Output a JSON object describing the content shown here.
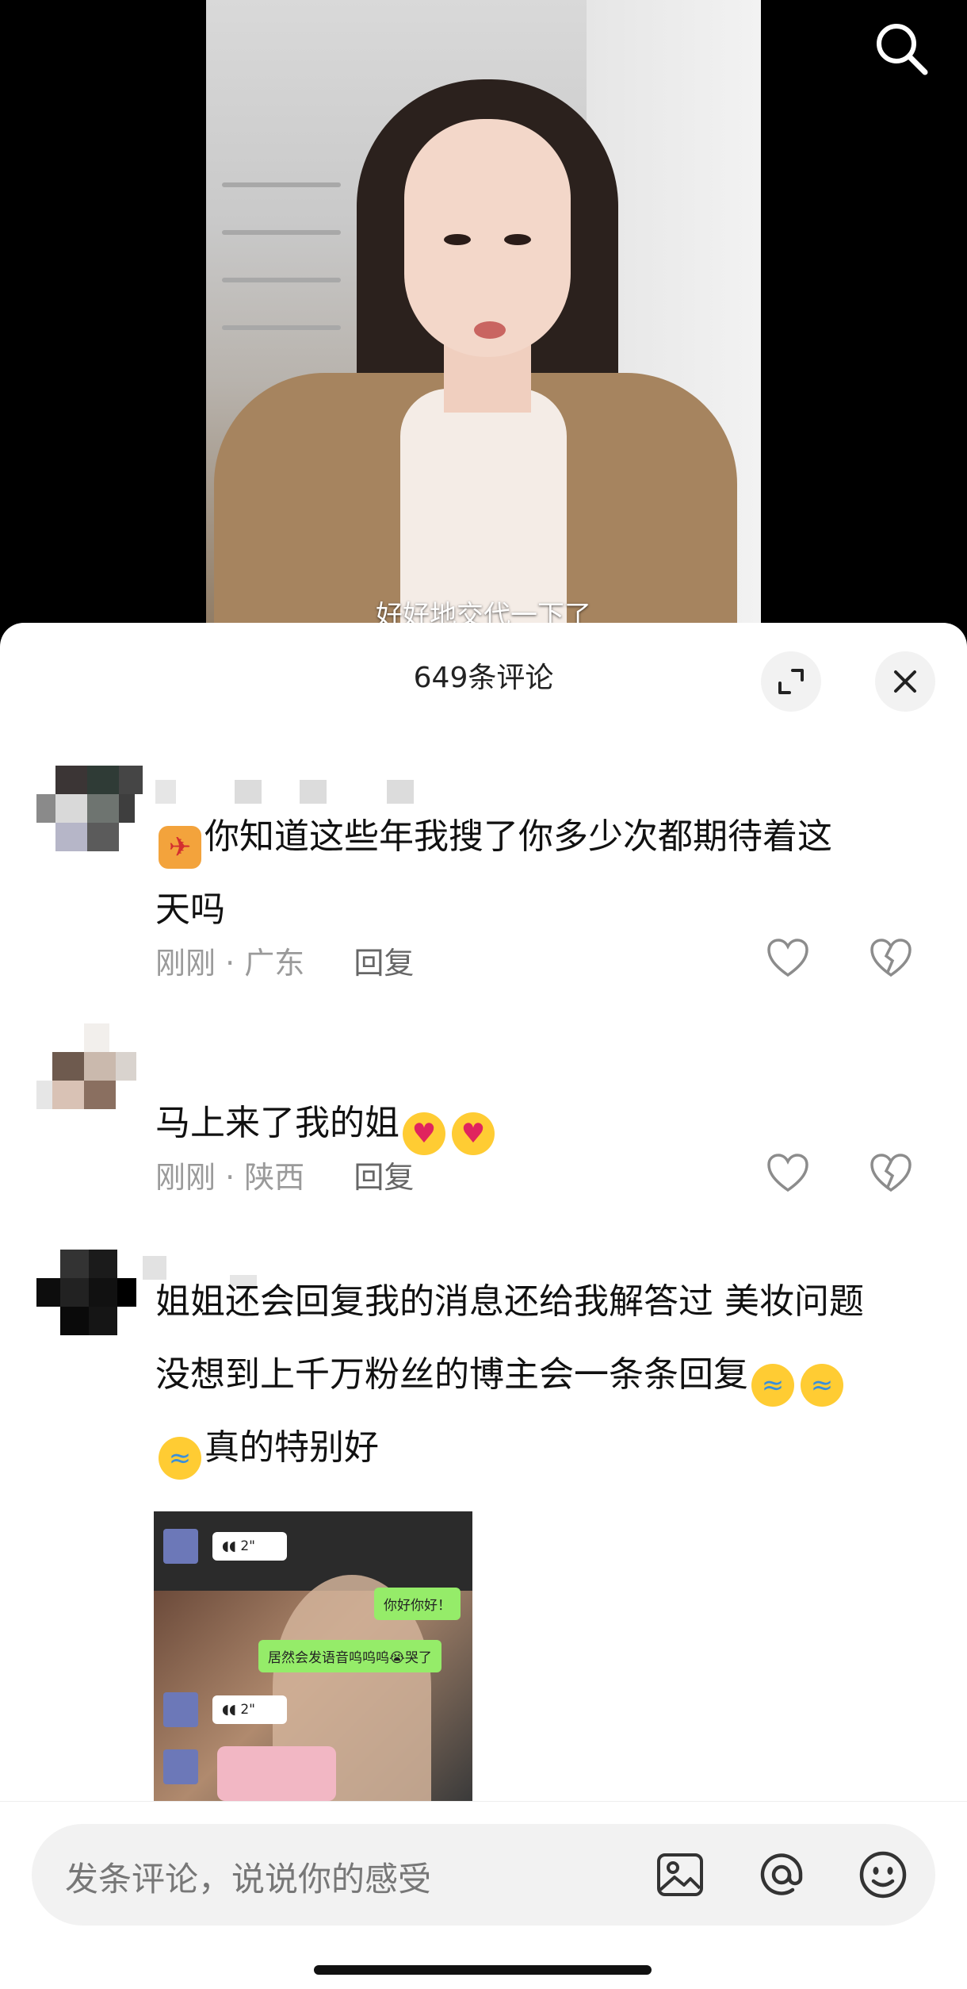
{
  "video": {
    "subtitle": "好好地交代一下了"
  },
  "comments_panel": {
    "title": "649条评论"
  },
  "comments": [
    {
      "text_line1": "你知道这些年我搜了你多少次都期待着这",
      "text_line2": "天吗",
      "time": "刚刚",
      "location": "广东",
      "reply_label": "回复"
    },
    {
      "text": "马上来了我的姐",
      "time": "刚刚",
      "location": "陕西",
      "reply_label": "回复"
    },
    {
      "text_line1": "姐姐还会回复我的消息还给我解答过 美妆问题",
      "text_line2": "没想到上千万粉丝的博主会一条条回复",
      "text_line3": "真的特别好",
      "image_chat": {
        "voice1": "2\"",
        "msg1": "你好你好！",
        "msg2": "居然会发语音呜呜呜😭哭了",
        "voice2": "2\""
      }
    }
  ],
  "input": {
    "placeholder": "发条评论，说说你的感受"
  },
  "icons": {
    "search": "search-icon",
    "expand": "expand-icon",
    "close": "close-icon",
    "like": "heart-outline-icon",
    "dislike": "broken-heart-icon",
    "image": "image-icon",
    "mention": "at-icon",
    "emoji": "emoji-icon"
  }
}
